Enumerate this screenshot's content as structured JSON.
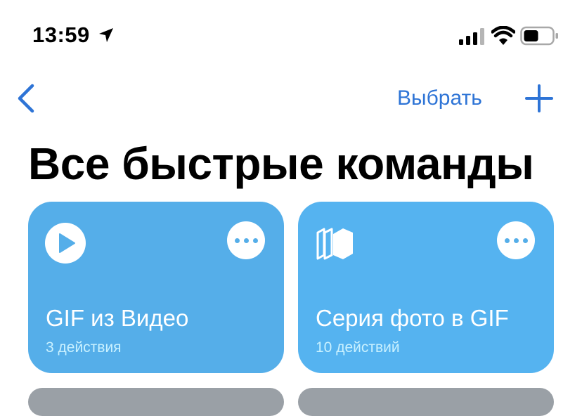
{
  "status_bar": {
    "time": "13:59",
    "icons": [
      "location-arrow-icon",
      "cellular-signal-icon",
      "wifi-icon",
      "battery-icon"
    ]
  },
  "nav": {
    "back_icon": "chevron-left-icon",
    "select_label": "Выбрать",
    "add_icon": "plus-icon"
  },
  "title": "Все быстрые команды",
  "colors": {
    "accent": "#2e74d6",
    "card": "#55aee9",
    "card_subtitle": "#c9f1ff"
  },
  "shortcuts": [
    {
      "title": "GIF из Видео",
      "subtitle": "3 действия",
      "icon": "play-circle-icon"
    },
    {
      "title": "Серия фото в GIF",
      "subtitle": "10 действий",
      "icon": "photo-stack-icon"
    }
  ]
}
